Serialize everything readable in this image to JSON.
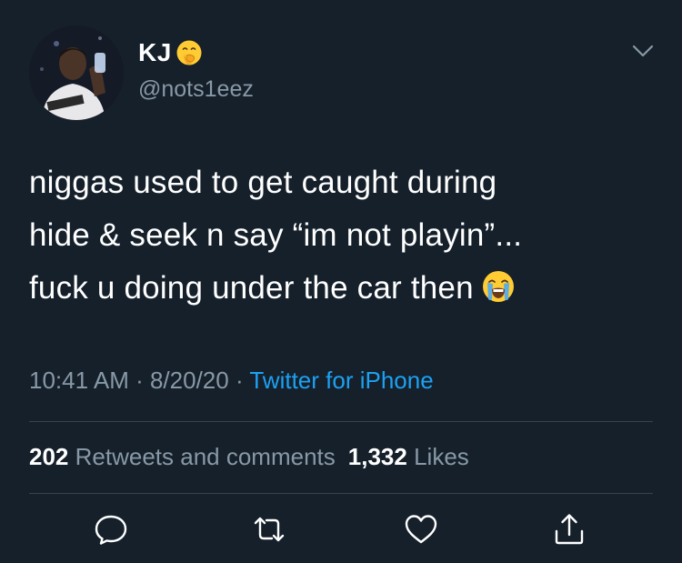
{
  "author": {
    "display_name": "KJ",
    "name_emoji": "face-with-hand-over-mouth-emoji",
    "handle": "@nots1eez",
    "avatar_icon": "profile-avatar"
  },
  "tweet": {
    "lines": [
      "niggas used to get caught during",
      "hide & seek n say “im not playin”...",
      "fuck u doing under the car then"
    ],
    "trailing_emoji": "loudly-crying-face-emoji"
  },
  "meta": {
    "time": "10:41 AM",
    "sep1": " · ",
    "date": "8/20/20",
    "sep2": " · ",
    "source": "Twitter for iPhone"
  },
  "stats": {
    "retweets_count": "202",
    "retweets_label": "Retweets and comments",
    "likes_count": "1,332",
    "likes_label": "Likes"
  },
  "actions": {
    "reply_icon": "reply-icon",
    "retweet_icon": "retweet-icon",
    "like_icon": "heart-icon",
    "share_icon": "share-icon"
  },
  "colors": {
    "background": "#15202b",
    "text_primary": "#ffffff",
    "text_secondary": "#8899a6",
    "accent": "#1da1f2",
    "divider": "#38444d"
  }
}
